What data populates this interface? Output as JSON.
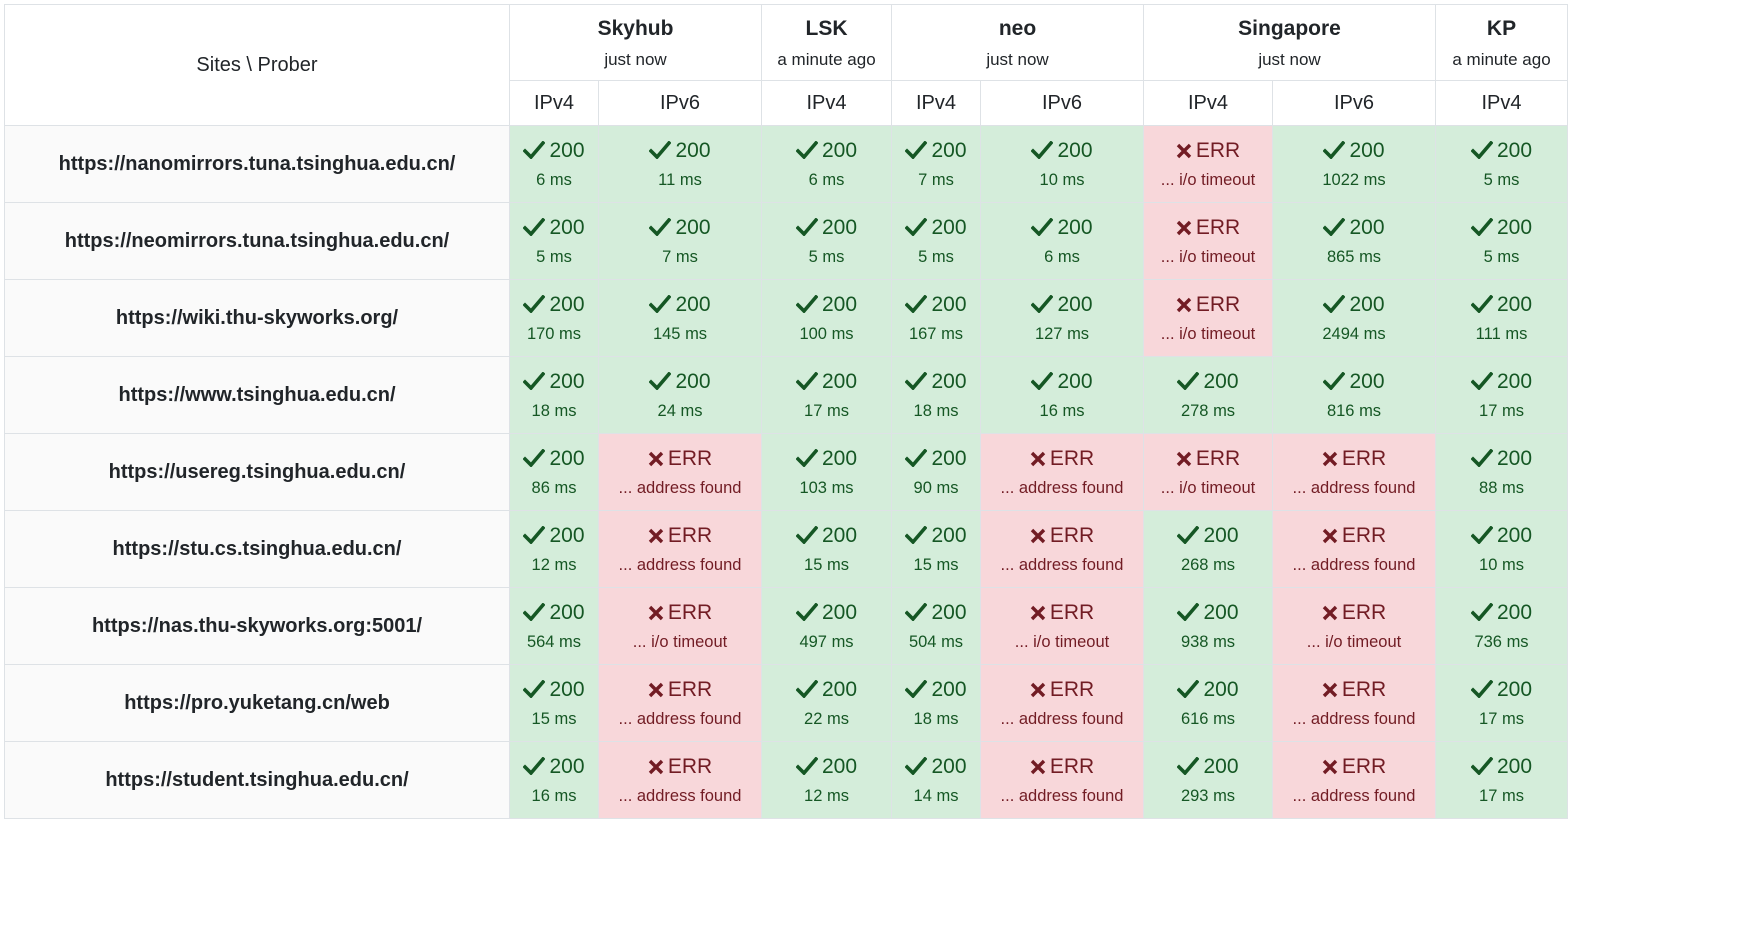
{
  "header": {
    "corner_label": "Sites \\ Prober",
    "probers": [
      {
        "name": "Skyhub",
        "time": "just now",
        "protocols": [
          "IPv4",
          "IPv6"
        ]
      },
      {
        "name": "LSK",
        "time": "a minute ago",
        "protocols": [
          "IPv4"
        ]
      },
      {
        "name": "neo",
        "time": "just now",
        "protocols": [
          "IPv4",
          "IPv6"
        ]
      },
      {
        "name": "Singapore",
        "time": "just now",
        "protocols": [
          "IPv4",
          "IPv6"
        ]
      },
      {
        "name": "KP",
        "time": "a minute ago",
        "protocols": [
          "IPv4"
        ]
      }
    ]
  },
  "status_colors": {
    "ok_bg": "#d4edda",
    "ok_text": "#155724",
    "err_bg": "#f8d7da",
    "err_text": "#721c24"
  },
  "rows": [
    {
      "site": "https://nanomirrors.tuna.tsinghua.edu.cn/",
      "cells": [
        {
          "status": "ok",
          "code": "200",
          "detail": "6 ms"
        },
        {
          "status": "ok",
          "code": "200",
          "detail": "11 ms"
        },
        {
          "status": "ok",
          "code": "200",
          "detail": "6 ms"
        },
        {
          "status": "ok",
          "code": "200",
          "detail": "7 ms"
        },
        {
          "status": "ok",
          "code": "200",
          "detail": "10 ms"
        },
        {
          "status": "err",
          "code": "ERR",
          "detail": "... i/o timeout"
        },
        {
          "status": "ok",
          "code": "200",
          "detail": "1022 ms"
        },
        {
          "status": "ok",
          "code": "200",
          "detail": "5 ms"
        }
      ]
    },
    {
      "site": "https://neomirrors.tuna.tsinghua.edu.cn/",
      "cells": [
        {
          "status": "ok",
          "code": "200",
          "detail": "5 ms"
        },
        {
          "status": "ok",
          "code": "200",
          "detail": "7 ms"
        },
        {
          "status": "ok",
          "code": "200",
          "detail": "5 ms"
        },
        {
          "status": "ok",
          "code": "200",
          "detail": "5 ms"
        },
        {
          "status": "ok",
          "code": "200",
          "detail": "6 ms"
        },
        {
          "status": "err",
          "code": "ERR",
          "detail": "... i/o timeout"
        },
        {
          "status": "ok",
          "code": "200",
          "detail": "865 ms"
        },
        {
          "status": "ok",
          "code": "200",
          "detail": "5 ms"
        }
      ]
    },
    {
      "site": "https://wiki.thu-skyworks.org/",
      "cells": [
        {
          "status": "ok",
          "code": "200",
          "detail": "170 ms"
        },
        {
          "status": "ok",
          "code": "200",
          "detail": "145 ms"
        },
        {
          "status": "ok",
          "code": "200",
          "detail": "100 ms"
        },
        {
          "status": "ok",
          "code": "200",
          "detail": "167 ms"
        },
        {
          "status": "ok",
          "code": "200",
          "detail": "127 ms"
        },
        {
          "status": "err",
          "code": "ERR",
          "detail": "... i/o timeout"
        },
        {
          "status": "ok",
          "code": "200",
          "detail": "2494 ms"
        },
        {
          "status": "ok",
          "code": "200",
          "detail": "111 ms"
        }
      ]
    },
    {
      "site": "https://www.tsinghua.edu.cn/",
      "cells": [
        {
          "status": "ok",
          "code": "200",
          "detail": "18 ms"
        },
        {
          "status": "ok",
          "code": "200",
          "detail": "24 ms"
        },
        {
          "status": "ok",
          "code": "200",
          "detail": "17 ms"
        },
        {
          "status": "ok",
          "code": "200",
          "detail": "18 ms"
        },
        {
          "status": "ok",
          "code": "200",
          "detail": "16 ms"
        },
        {
          "status": "ok",
          "code": "200",
          "detail": "278 ms"
        },
        {
          "status": "ok",
          "code": "200",
          "detail": "816 ms"
        },
        {
          "status": "ok",
          "code": "200",
          "detail": "17 ms"
        }
      ]
    },
    {
      "site": "https://usereg.tsinghua.edu.cn/",
      "cells": [
        {
          "status": "ok",
          "code": "200",
          "detail": "86 ms"
        },
        {
          "status": "err",
          "code": "ERR",
          "detail": "... address found"
        },
        {
          "status": "ok",
          "code": "200",
          "detail": "103 ms"
        },
        {
          "status": "ok",
          "code": "200",
          "detail": "90 ms"
        },
        {
          "status": "err",
          "code": "ERR",
          "detail": "... address found"
        },
        {
          "status": "err",
          "code": "ERR",
          "detail": "... i/o timeout"
        },
        {
          "status": "err",
          "code": "ERR",
          "detail": "... address found"
        },
        {
          "status": "ok",
          "code": "200",
          "detail": "88 ms"
        }
      ]
    },
    {
      "site": "https://stu.cs.tsinghua.edu.cn/",
      "cells": [
        {
          "status": "ok",
          "code": "200",
          "detail": "12 ms"
        },
        {
          "status": "err",
          "code": "ERR",
          "detail": "... address found"
        },
        {
          "status": "ok",
          "code": "200",
          "detail": "15 ms"
        },
        {
          "status": "ok",
          "code": "200",
          "detail": "15 ms"
        },
        {
          "status": "err",
          "code": "ERR",
          "detail": "... address found"
        },
        {
          "status": "ok",
          "code": "200",
          "detail": "268 ms"
        },
        {
          "status": "err",
          "code": "ERR",
          "detail": "... address found"
        },
        {
          "status": "ok",
          "code": "200",
          "detail": "10 ms"
        }
      ]
    },
    {
      "site": "https://nas.thu-skyworks.org:5001/",
      "cells": [
        {
          "status": "ok",
          "code": "200",
          "detail": "564 ms"
        },
        {
          "status": "err",
          "code": "ERR",
          "detail": "... i/o timeout"
        },
        {
          "status": "ok",
          "code": "200",
          "detail": "497 ms"
        },
        {
          "status": "ok",
          "code": "200",
          "detail": "504 ms"
        },
        {
          "status": "err",
          "code": "ERR",
          "detail": "... i/o timeout"
        },
        {
          "status": "ok",
          "code": "200",
          "detail": "938 ms"
        },
        {
          "status": "err",
          "code": "ERR",
          "detail": "... i/o timeout"
        },
        {
          "status": "ok",
          "code": "200",
          "detail": "736 ms"
        }
      ]
    },
    {
      "site": "https://pro.yuketang.cn/web",
      "cells": [
        {
          "status": "ok",
          "code": "200",
          "detail": "15 ms"
        },
        {
          "status": "err",
          "code": "ERR",
          "detail": "... address found"
        },
        {
          "status": "ok",
          "code": "200",
          "detail": "22 ms"
        },
        {
          "status": "ok",
          "code": "200",
          "detail": "18 ms"
        },
        {
          "status": "err",
          "code": "ERR",
          "detail": "... address found"
        },
        {
          "status": "ok",
          "code": "200",
          "detail": "616 ms"
        },
        {
          "status": "err",
          "code": "ERR",
          "detail": "... address found"
        },
        {
          "status": "ok",
          "code": "200",
          "detail": "17 ms"
        }
      ]
    },
    {
      "site": "https://student.tsinghua.edu.cn/",
      "cells": [
        {
          "status": "ok",
          "code": "200",
          "detail": "16 ms"
        },
        {
          "status": "err",
          "code": "ERR",
          "detail": "... address found"
        },
        {
          "status": "ok",
          "code": "200",
          "detail": "12 ms"
        },
        {
          "status": "ok",
          "code": "200",
          "detail": "14 ms"
        },
        {
          "status": "err",
          "code": "ERR",
          "detail": "... address found"
        },
        {
          "status": "ok",
          "code": "200",
          "detail": "293 ms"
        },
        {
          "status": "err",
          "code": "ERR",
          "detail": "... address found"
        },
        {
          "status": "ok",
          "code": "200",
          "detail": "17 ms"
        }
      ]
    }
  ]
}
